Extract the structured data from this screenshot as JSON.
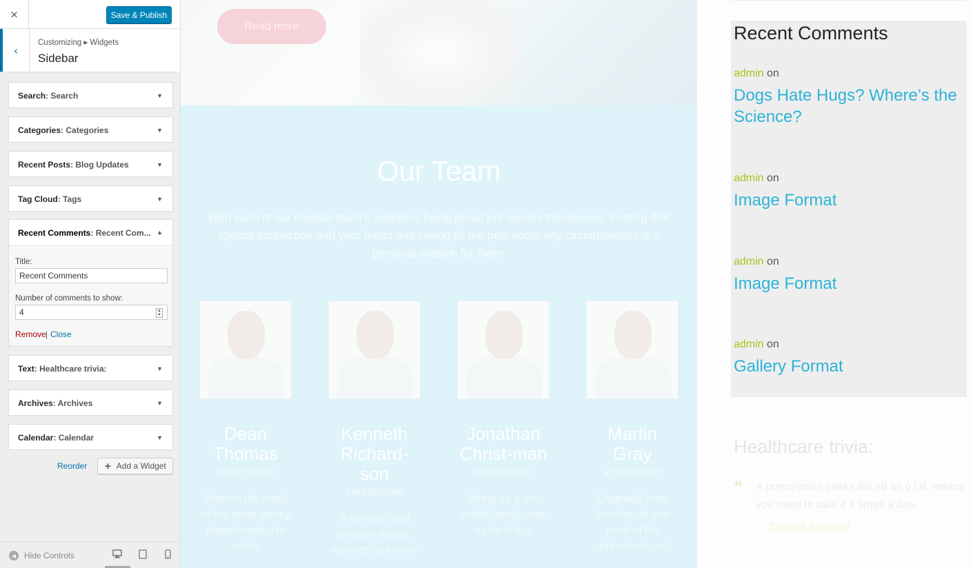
{
  "customizer": {
    "close_icon": "×",
    "save_label": "Save & Publish",
    "back_icon": "‹",
    "breadcrumb": "Customizing ▸ Widgets",
    "section_title": "Sidebar",
    "widgets": [
      {
        "type": "Search",
        "title": ": Search"
      },
      {
        "type": "Categories",
        "title": ": Categories"
      },
      {
        "type": "Recent Posts",
        "title": ": Blog Updates"
      },
      {
        "type": "Tag Cloud",
        "title": ": Tags"
      }
    ],
    "open_widget": {
      "type": "Recent Comments",
      "title": ": Recent Com...",
      "title_label": "Title:",
      "title_value": "Recent Comments",
      "count_label": "Number of comments to show:",
      "count_value": "4",
      "remove_label": "Remove",
      "separator": "|",
      "close_label": "Close"
    },
    "widgets_after": [
      {
        "type": "Text",
        "title": ": Healthcare trivia:"
      },
      {
        "type": "Archives",
        "title": ": Archives"
      },
      {
        "type": "Calendar",
        "title": ": Calendar"
      }
    ],
    "reorder_label": "Reorder",
    "add_widget_label": "Add a Widget",
    "hide_controls_label": "Hide Controls",
    "accent_color": "#0085ba"
  },
  "preview": {
    "read_more": "Read more",
    "team_title": "Our Team",
    "team_desc": "With each of our medical team's members being proud pet owners themselves, forming that special connection with your friend and saving all the pets under any circumstances is a personal mission for them.",
    "members": [
      {
        "name": "Dean Thomas",
        "role": "Veterinarian",
        "bio": "Dean is the head of our emer-gency depart-ment. He works"
      },
      {
        "name": "Kenneth Richard-son",
        "role": "Veterinarian",
        "bio": "A talented and creative leader, Kenneth is known"
      },
      {
        "name": "Jonathan Christ-man",
        "role": "Veterinarian",
        "bio": "Being as a de-voted family man as he is it is"
      },
      {
        "name": "Martin Gray",
        "role": "Veterinarian",
        "bio": "Originally from London, at one point of his sophomore col-"
      }
    ],
    "recent_comments": {
      "title": "Recent Comments",
      "items": [
        {
          "author": "admin",
          "on": " on",
          "post": "Dogs Hate Hugs? Where’s the Science?"
        },
        {
          "author": "admin",
          "on": " on",
          "post": "Image Format"
        },
        {
          "author": "admin",
          "on": " on",
          "post": "Image Format"
        },
        {
          "author": "admin",
          "on": " on",
          "post": "Gallery Format"
        }
      ]
    },
    "trivia": {
      "title": "Healthcare trivia:",
      "quote": "A prescription intake list ed as q.i.d. means you need to take it 4 times a day.",
      "author": "— Donald Shepard"
    }
  }
}
